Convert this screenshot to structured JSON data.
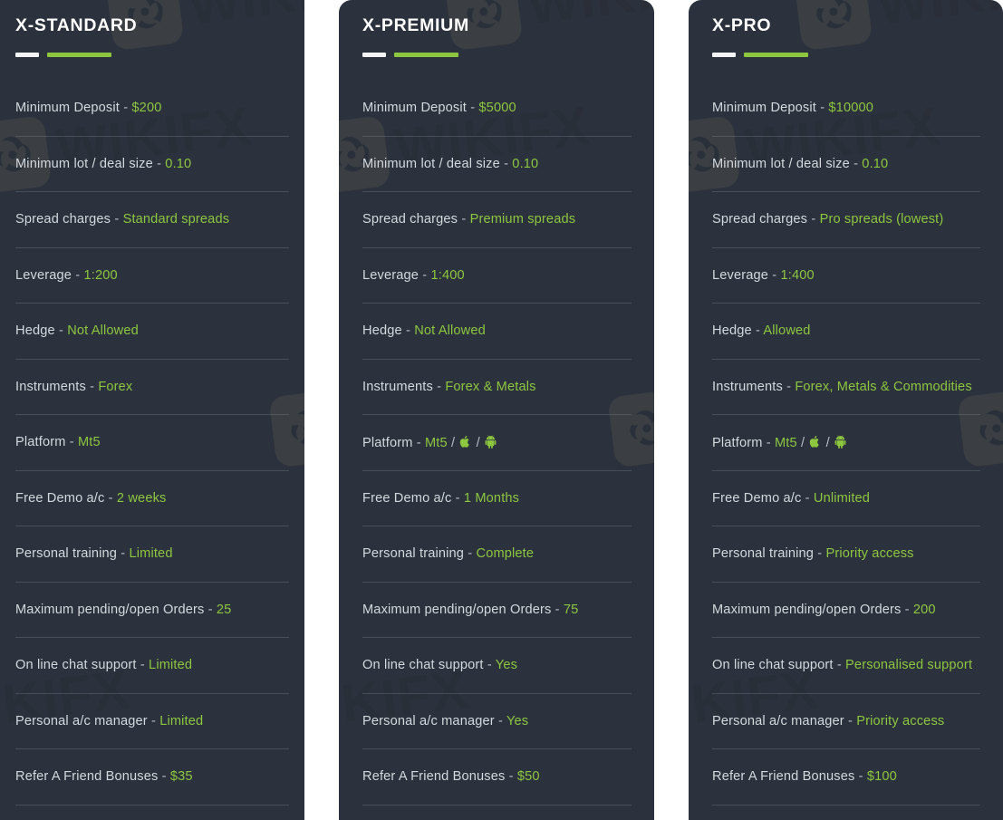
{
  "theme": {
    "card_bg": "#2c323d",
    "page_bg": "#ffffff",
    "accent_green": "#8dc63f",
    "label_color": "#d3d8de",
    "divider_color": "rgba(175,190,205,0.20)"
  },
  "watermark": {
    "word": "WIKIFX",
    "logo_icon": "wikifx-eagle-logo-icon"
  },
  "accounts": [
    {
      "title": "X-STANDARD",
      "rows": [
        {
          "label": "Minimum Deposit",
          "sep": "-",
          "value": "$200"
        },
        {
          "label": "Minimum lot / deal size",
          "sep": "-",
          "value": "0.10"
        },
        {
          "label": "Spread charges",
          "sep": "-",
          "value": "Standard spreads"
        },
        {
          "label": "Leverage",
          "sep": "-",
          "value": "1:200"
        },
        {
          "label": "Hedge",
          "sep": "-",
          "value": "Not Allowed"
        },
        {
          "label": "Instruments",
          "sep": "-",
          "value": "Forex"
        },
        {
          "label": "Platform",
          "sep": "-",
          "value": "Mt5",
          "icons": []
        },
        {
          "label": "Free Demo a/c",
          "sep": "-",
          "value": "2 weeks"
        },
        {
          "label": "Personal training",
          "sep": "-",
          "value": "Limited"
        },
        {
          "label": "Maximum pending/open Orders",
          "sep": "-",
          "value": "25"
        },
        {
          "label": "On line chat support",
          "sep": "-",
          "value": "Limited"
        },
        {
          "label": "Personal a/c manager",
          "sep": "-",
          "value": "Limited"
        },
        {
          "label": "Refer A Friend Bonuses",
          "sep": "-",
          "value": "$35"
        }
      ]
    },
    {
      "title": "X-PREMIUM",
      "rows": [
        {
          "label": "Minimum Deposit",
          "sep": "-",
          "value": "$5000"
        },
        {
          "label": "Minimum lot / deal size",
          "sep": "-",
          "value": "0.10"
        },
        {
          "label": "Spread charges",
          "sep": "-",
          "value": "Premium spreads"
        },
        {
          "label": "Leverage",
          "sep": "-",
          "value": "1:400"
        },
        {
          "label": "Hedge",
          "sep": "-",
          "value": "Not Allowed"
        },
        {
          "label": "Instruments",
          "sep": "-",
          "value": "Forex & Metals"
        },
        {
          "label": "Platform",
          "sep": "-",
          "value": "Mt5",
          "icons": [
            "apple-icon",
            "android-icon"
          ]
        },
        {
          "label": "Free Demo a/c",
          "sep": "-",
          "value": "1 Months"
        },
        {
          "label": "Personal training",
          "sep": "-",
          "value": "Complete"
        },
        {
          "label": "Maximum pending/open Orders",
          "sep": "-",
          "value": "75"
        },
        {
          "label": "On line chat support",
          "sep": "-",
          "value": "Yes"
        },
        {
          "label": "Personal a/c manager",
          "sep": "-",
          "value": "Yes"
        },
        {
          "label": "Refer A Friend Bonuses",
          "sep": "-",
          "value": "$50"
        }
      ]
    },
    {
      "title": "X-PRO",
      "rows": [
        {
          "label": "Minimum Deposit",
          "sep": "-",
          "value": "$10000"
        },
        {
          "label": "Minimum lot / deal size",
          "sep": "-",
          "value": "0.10"
        },
        {
          "label": "Spread charges",
          "sep": "-",
          "value": "Pro spreads (lowest)"
        },
        {
          "label": "Leverage",
          "sep": "-",
          "value": "1:400"
        },
        {
          "label": "Hedge",
          "sep": "-",
          "value": "Allowed"
        },
        {
          "label": "Instruments",
          "sep": "-",
          "value": "Forex, Metals & Commodities"
        },
        {
          "label": "Platform",
          "sep": "-",
          "value": "Mt5",
          "icons": [
            "apple-icon",
            "android-icon"
          ]
        },
        {
          "label": "Free Demo a/c",
          "sep": "-",
          "value": "Unlimited"
        },
        {
          "label": "Personal training",
          "sep": "-",
          "value": "Priority access"
        },
        {
          "label": "Maximum pending/open Orders",
          "sep": "-",
          "value": "200"
        },
        {
          "label": "On line chat support",
          "sep": "-",
          "value": "Personalised support"
        },
        {
          "label": "Personal a/c manager",
          "sep": "-",
          "value": "Priority access"
        },
        {
          "label": "Refer A Friend Bonuses",
          "sep": "-",
          "value": "$100"
        }
      ]
    }
  ]
}
